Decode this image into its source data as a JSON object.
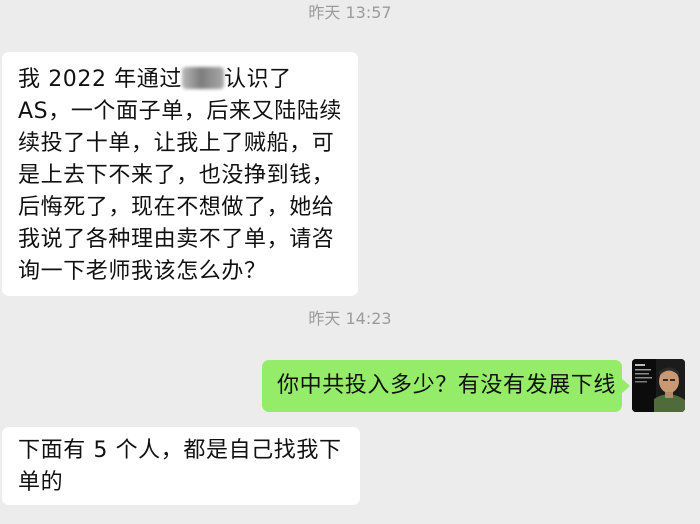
{
  "chat": {
    "timestamp_1": "昨天 13:57",
    "timestamp_2": "昨天 14:23",
    "msg1": {
      "part1": "我 2022 年通过",
      "part2": "认识了 AS，一个面子单，后来又陆陆续续投了十单，让我上了贼船，可是上去下不来了，也没挣到钱，后悔死了，现在不想做了，她给我说了各种理由卖不了单，请咨询一下老师我该怎么办？"
    },
    "msg2": "你中共投入多少？有没有发展下线",
    "msg3": "下面有 5 个人，都是自己找我下单的"
  },
  "colors": {
    "background": "#ececec",
    "incoming_bubble": "#ffffff",
    "outgoing_bubble": "#95ec69",
    "timestamp_text": "#9b9b9b"
  }
}
